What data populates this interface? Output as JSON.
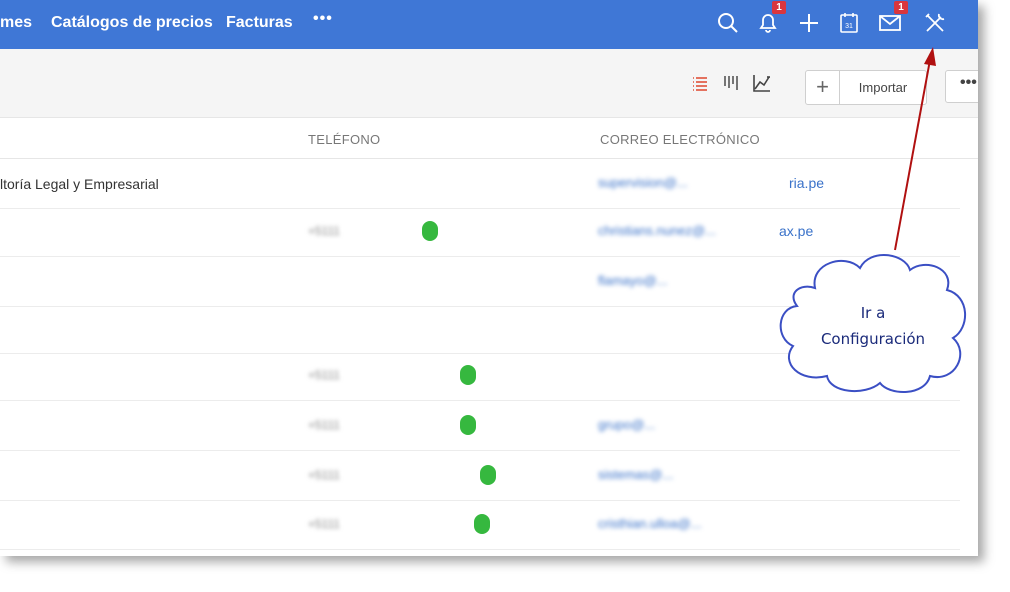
{
  "topbar": {
    "nav": [
      {
        "label": "mes"
      },
      {
        "label": "Catálogos de precios"
      },
      {
        "label": "Facturas"
      }
    ],
    "more_label": "•••",
    "notifications_badge": "1",
    "mail_badge": "1",
    "calendar_day": "31",
    "icons": [
      "search-icon",
      "bell-icon",
      "plus-icon",
      "calendar-icon",
      "mail-icon",
      "tools-icon"
    ],
    "color": "#3f77d6"
  },
  "toolbar": {
    "plus_label": "+",
    "import_label": "Importar",
    "more_label": "•••",
    "view_icons": [
      "list-view-icon",
      "kanban-view-icon",
      "chart-view-icon"
    ]
  },
  "table": {
    "headers": {
      "phone": "TELÉFONO",
      "email": "CORREO ELECTRÓNICO"
    },
    "rows": [
      {
        "name": "ltoría Legal y Empresarial",
        "phone": "",
        "email": "supervision@...",
        "email_clear": "ria.pe"
      },
      {
        "name": "",
        "phone": "+5111",
        "email": "christians.nunez@...",
        "email_clear": "ax.pe"
      },
      {
        "name": "",
        "phone": "",
        "email": "flamayo@...",
        "email_clear": ""
      },
      {
        "name": "",
        "phone": "",
        "email": "",
        "email_clear": ""
      },
      {
        "name": "",
        "phone": "+5111",
        "email": "",
        "email_clear": ""
      },
      {
        "name": "",
        "phone": "+5111",
        "email": "grupo@...",
        "email_clear": ""
      },
      {
        "name": "",
        "phone": "+5111",
        "email": "sistemas@...",
        "email_clear": ""
      },
      {
        "name": "",
        "phone": "+5111",
        "email": "cristhian.ulloa@...",
        "email_clear": ""
      }
    ]
  },
  "callout": {
    "line1": "Ir a",
    "line2": "Configuración"
  }
}
